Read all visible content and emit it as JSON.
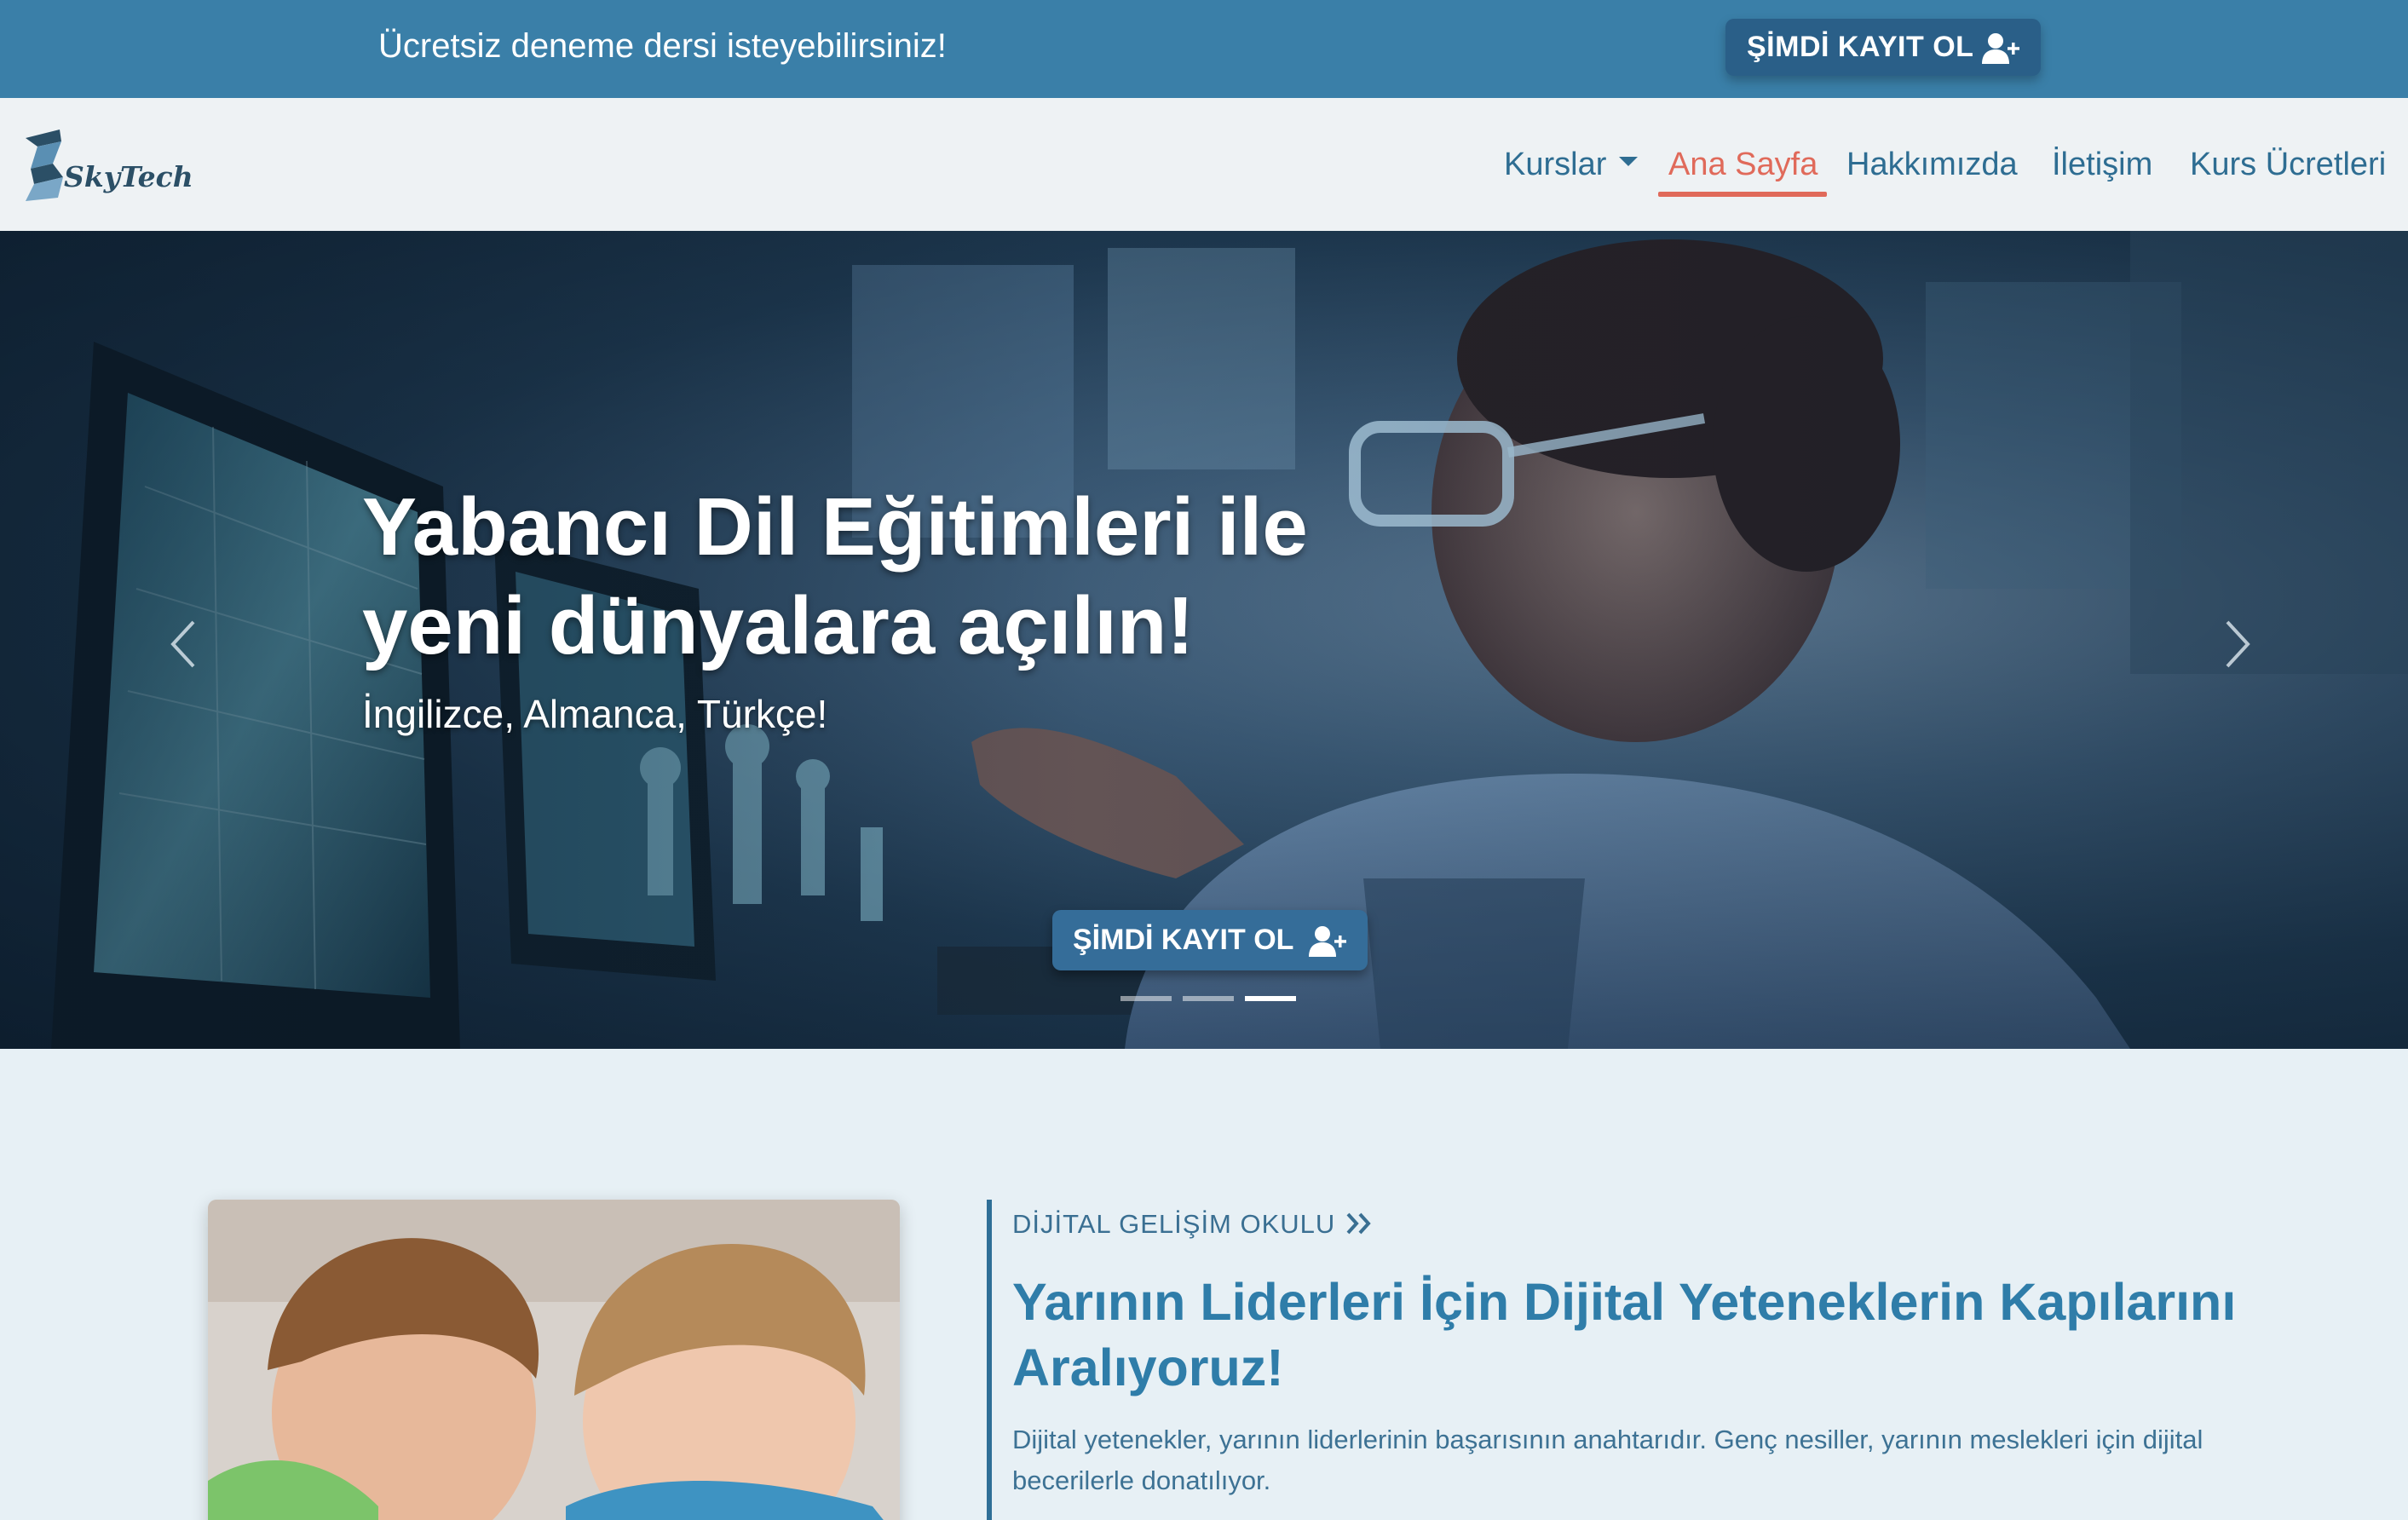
{
  "topbar": {
    "text": "Ücretsiz deneme dersi isteyebilirsiniz!",
    "button_label": "ŞİMDİ KAYIT OL"
  },
  "brand": {
    "logo_text": "SkyTech"
  },
  "nav": {
    "items": [
      {
        "label": "Kurslar"
      },
      {
        "label": "Ana Sayfa"
      },
      {
        "label": "Hakkımızda"
      },
      {
        "label": "İletişim"
      },
      {
        "label": "Kurs Ücretleri"
      }
    ],
    "active_index": 1
  },
  "hero": {
    "title_line1": "Yabancı Dil Eğitimleri ile",
    "title_line2": "yeni dünyalara açılın!",
    "subtitle": "İngilizce, Almanca, Türkçe!",
    "button_label": "ŞİMDİ KAYIT OL",
    "slide_count": 3,
    "active_slide": 3
  },
  "section": {
    "eyebrow": "DİJİTAL GELİŞİM OKULU",
    "headline": "Yarının Liderleri İçin Dijital Yeteneklerin Kapılarını Aralıyoruz!",
    "description": "Dijital yetenekler, yarının liderlerinin başarısının anahtarıdır. Genç nesiller, yarının meslekleri için dijital becerilerle donatılıyor."
  },
  "colors": {
    "topbar": "#3a7fa8",
    "button": "#2a5f88",
    "nav_text": "#2e6d92",
    "nav_active": "#e06a5a",
    "headline": "#2f7da9"
  },
  "icons": [
    "user-plus-icon",
    "chevron-left-icon",
    "chevron-right-icon",
    "double-chevron-right-icon",
    "caret-down-icon"
  ]
}
